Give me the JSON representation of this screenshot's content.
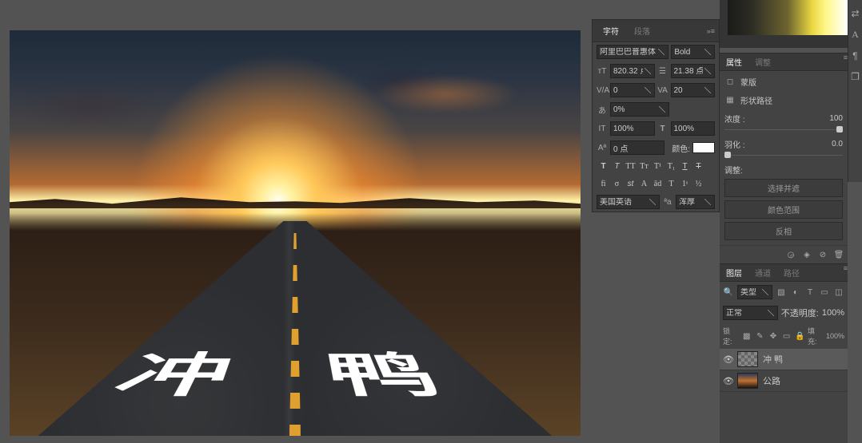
{
  "canvas": {
    "road_text": "冲 鸭"
  },
  "char_panel": {
    "tab_char": "字符",
    "tab_para": "段落",
    "font_family": "阿里巴巴普惠体",
    "font_style": "Bold",
    "size_lbl": "820.32 点",
    "leading_lbl": "21.38 点",
    "va": "0",
    "tracking": "20",
    "tsume": "0%",
    "vert_pct": "100%",
    "horiz_pct": "100%",
    "baseline": "0 点",
    "color_lbl": "颜色:",
    "lang": "美国英语",
    "aa": "浑厚"
  },
  "props": {
    "tab_prop": "属性",
    "tab_adj": "调整",
    "mask_title": "蒙版",
    "path_title": "形状路径",
    "density_lbl": "浓度 :",
    "density_val": "100",
    "feather_lbl": "羽化 :",
    "feather_val": "0.0",
    "refine_lbl": "调整:",
    "btn_select": "选择并遮",
    "btn_range": "颜色范围",
    "btn_invert": "反相"
  },
  "layers": {
    "tab_layers": "图层",
    "tab_channels": "通道",
    "tab_paths": "路径",
    "kind": "类型",
    "blend": "正常",
    "opacity_lbl": "不透明度:",
    "opacity_val": "100%",
    "lock_lbl": "锁定:",
    "fill_lbl": "填充:",
    "fill_val": "100%",
    "l1": "冲 鸭",
    "l2": "公路"
  }
}
